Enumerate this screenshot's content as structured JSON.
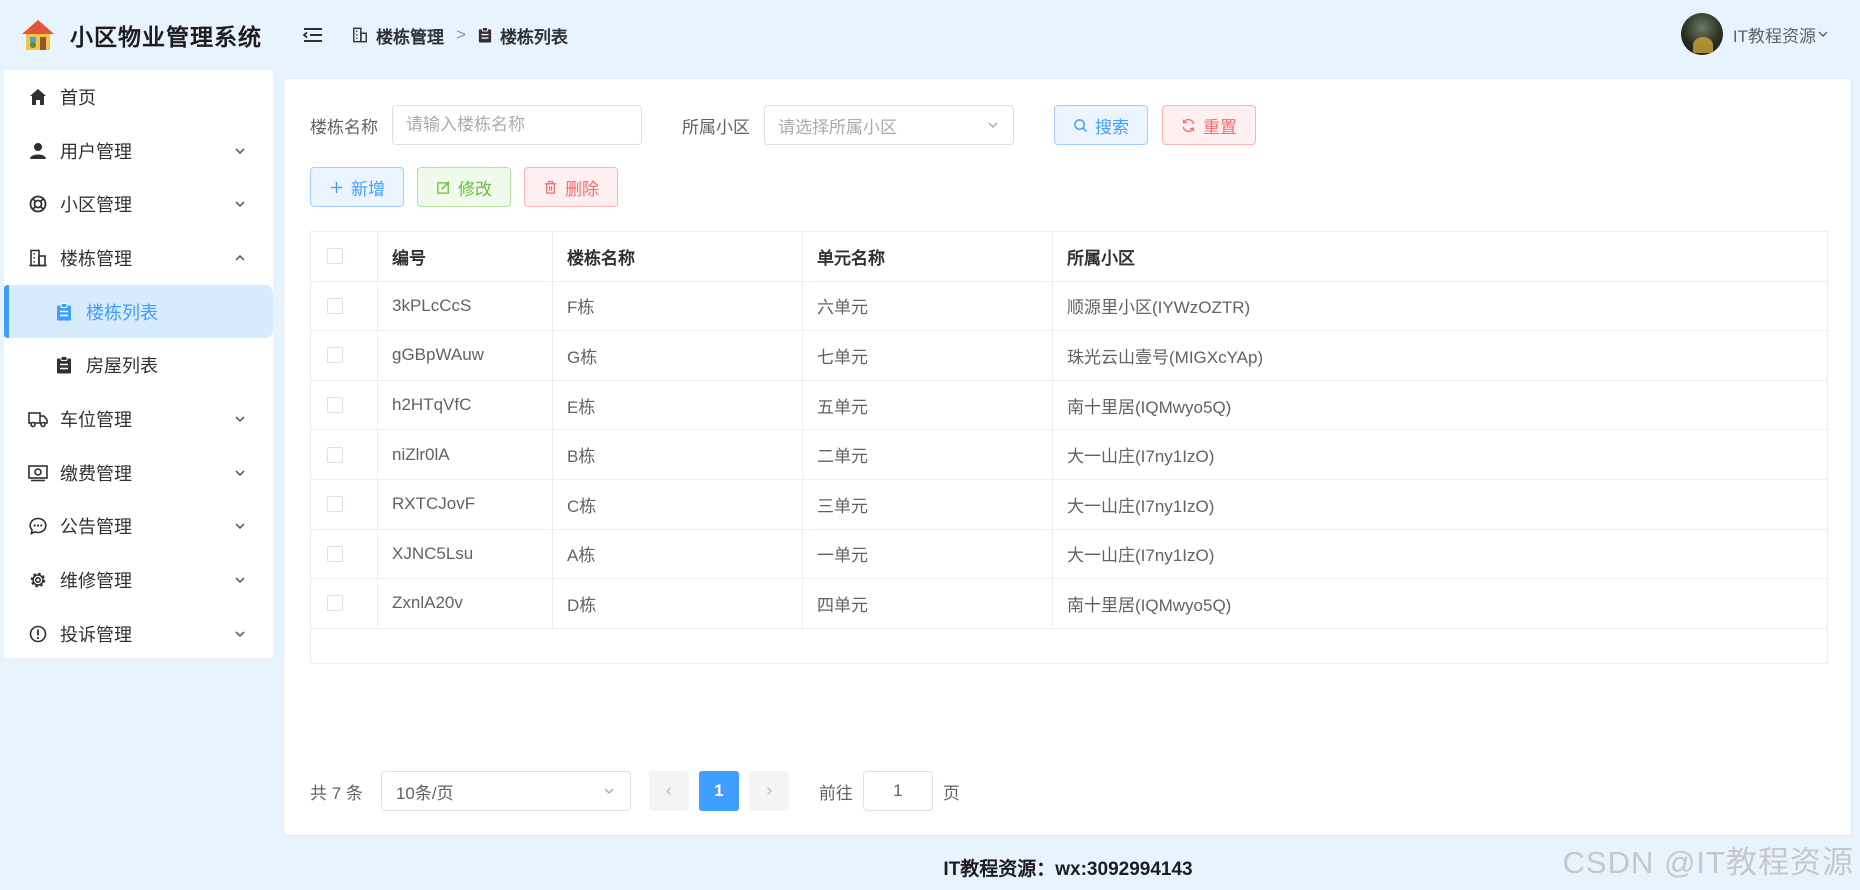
{
  "app": {
    "title": "小区物业管理系统"
  },
  "menu": {
    "items": [
      {
        "label": "首页",
        "icon": "home-icon",
        "arrow": ""
      },
      {
        "label": "用户管理",
        "icon": "user-icon",
        "arrow": "down"
      },
      {
        "label": "小区管理",
        "icon": "lifebuoy-icon",
        "arrow": "down"
      },
      {
        "label": "楼栋管理",
        "icon": "building-icon",
        "arrow": "up"
      },
      {
        "label": "楼栋列表",
        "icon": "clipboard-icon",
        "sub": true,
        "active": true
      },
      {
        "label": "房屋列表",
        "icon": "clipboard-icon",
        "sub": true
      },
      {
        "label": "车位管理",
        "icon": "truck-icon",
        "arrow": "down"
      },
      {
        "label": "缴费管理",
        "icon": "money-icon",
        "arrow": "down"
      },
      {
        "label": "公告管理",
        "icon": "chat-icon",
        "arrow": "down"
      },
      {
        "label": "维修管理",
        "icon": "gear-icon",
        "arrow": "down"
      },
      {
        "label": "投诉管理",
        "icon": "warning-icon",
        "arrow": "down"
      }
    ]
  },
  "header": {
    "breadcrumb": [
      "楼栋管理",
      "楼栋列表"
    ],
    "user_name": "IT教程资源"
  },
  "search": {
    "name_label": "楼栋名称",
    "name_placeholder": "请输入楼栋名称",
    "community_label": "所属小区",
    "community_placeholder": "请选择所属小区",
    "search_button": "搜索",
    "reset_button": "重置"
  },
  "actions": {
    "add": "新增",
    "edit": "修改",
    "delete": "删除"
  },
  "table": {
    "columns": [
      "编号",
      "楼栋名称",
      "单元名称",
      "所属小区"
    ],
    "rows": [
      [
        "3kPLcCcS",
        "F栋",
        "六单元",
        "顺源里小区(IYWzOZTR)"
      ],
      [
        "gGBpWAuw",
        "G栋",
        "七单元",
        "珠光云山壹号(MIGXcYAp)"
      ],
      [
        "h2HTqVfC",
        "E栋",
        "五单元",
        "南十里居(IQMwyo5Q)"
      ],
      [
        "niZlr0lA",
        "B栋",
        "二单元",
        "大一山庄(I7ny1IzO)"
      ],
      [
        "RXTCJovF",
        "C栋",
        "三单元",
        "大一山庄(I7ny1IzO)"
      ],
      [
        "XJNC5Lsu",
        "A栋",
        "一单元",
        "大一山庄(I7ny1IzO)"
      ],
      [
        "ZxnlA20v",
        "D栋",
        "四单元",
        "南十里居(IQMwyo5Q)"
      ]
    ]
  },
  "pagination": {
    "total": "共 7 条",
    "page_size": "10条/页",
    "current": "1",
    "goto_label": "前往",
    "goto_value": "1",
    "page_unit": "页"
  },
  "footer": {
    "text": "IT教程资源：wx:3092994143"
  },
  "watermark": "CSDN @IT教程资源",
  "colors": {
    "primary": "#409eff",
    "danger": "#f56c6c",
    "success": "#67c23a",
    "sidebar_bg": "#e8f4fd"
  }
}
